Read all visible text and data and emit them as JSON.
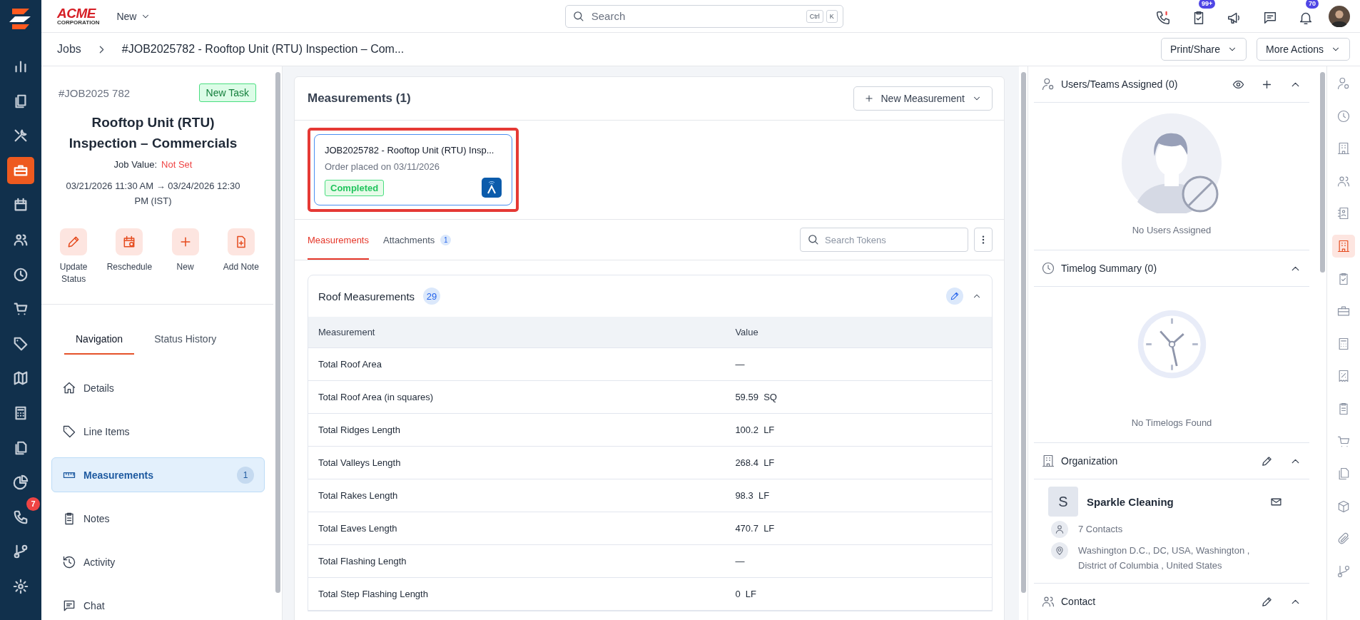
{
  "brand": {
    "name": "ACME",
    "tagline": "CORPORATION"
  },
  "top_bar": {
    "new_menu": "New",
    "search": {
      "placeholder": "Search",
      "keys": [
        "Ctrl",
        "K"
      ]
    },
    "task_badge": "99+",
    "bell_badge": "70"
  },
  "breadcrumb": {
    "parent": "Jobs",
    "title": "#JOB2025782 - Rooftop Unit (RTU) Inspection – Com...",
    "actions": [
      "Print/Share",
      "More Actions"
    ]
  },
  "left_rail": [
    {
      "selected": false
    },
    {
      "selected": false
    },
    {
      "selected": false
    },
    {
      "selected": true
    },
    {
      "selected": false
    },
    {
      "selected": false
    },
    {
      "selected": false
    },
    {
      "selected": false
    },
    {
      "selected": false
    },
    {
      "selected": false
    },
    {
      "selected": false
    },
    {
      "selected": false
    },
    {
      "selected": false
    },
    {
      "selected": false,
      "badge": "7"
    },
    {
      "selected": false
    },
    {
      "selected": false
    }
  ],
  "job": {
    "number": "#JOB2025 782",
    "tag": "New Task",
    "title": "Rooftop Unit (RTU) Inspection – Commercials",
    "value_label": "Job Value:",
    "value": "Not Set",
    "schedule": "03/21/2026 11:30 AM → 03/24/2026 12:30 PM (IST)",
    "actions": [
      "Update Status",
      "Reschedule",
      "New",
      "Add Note"
    ]
  },
  "panel_tabs": [
    {
      "label": "Navigation",
      "selected": true
    },
    {
      "label": "Status History",
      "selected": false
    }
  ],
  "nav": [
    {
      "label": "Details",
      "selected": false
    },
    {
      "label": "Line Items",
      "selected": false
    },
    {
      "label": "Measurements",
      "count": "1",
      "selected": true
    },
    {
      "label": "Notes",
      "selected": false
    },
    {
      "label": "Activity",
      "selected": false
    },
    {
      "label": "Chat",
      "selected": false
    }
  ],
  "measurements": {
    "title": "Measurements (1)",
    "new_button": "New Measurement",
    "cards": [
      {
        "title": "JOB2025782 - Rooftop Unit (RTU) Insp...",
        "subtitle": "Order placed on 03/11/2026",
        "status": "Completed",
        "highlighted": true
      }
    ],
    "tabs": [
      {
        "label": "Measurements",
        "selected": true
      },
      {
        "label": "Attachments",
        "count": "1",
        "selected": false
      }
    ],
    "search": {
      "placeholder": "Search Tokens"
    },
    "section": {
      "title": "Roof Measurements",
      "count": "29",
      "expanded": true,
      "columns": [
        "Measurement",
        "Value"
      ],
      "rows": [
        [
          "Total Roof Area",
          "—"
        ],
        [
          "Total Roof Area (in squares)",
          "59.59  SQ"
        ],
        [
          "Total Ridges Length",
          "100.2  LF"
        ],
        [
          "Total Valleys Length",
          "268.4  LF"
        ],
        [
          "Total Rakes Length",
          "98.3  LF"
        ],
        [
          "Total Eaves Length",
          "470.7  LF"
        ],
        [
          "Total Flashing Length",
          "—"
        ],
        [
          "Total Step Flashing Length",
          "0  LF"
        ]
      ]
    }
  },
  "right_panel": {
    "users": {
      "title": "Users/Teams Assigned (0)",
      "empty": "No Users Assigned"
    },
    "timelog": {
      "title": "Timelog Summary (0)",
      "empty": "No Timelogs Found"
    },
    "organization": {
      "title": "Organization",
      "initial": "S",
      "name": "Sparkle Cleaning",
      "contacts": "7 Contacts",
      "address": "Washington D.C., DC, USA, Washington , District of Columbia , United States"
    },
    "contact": {
      "title": "Contact"
    }
  },
  "right_rail": [
    {
      "selected": false
    },
    {
      "selected": false
    },
    {
      "selected": false
    },
    {
      "selected": false
    },
    {
      "selected": false
    },
    {
      "selected": true
    },
    {
      "selected": false
    },
    {
      "selected": false
    },
    {
      "selected": false
    },
    {
      "selected": false
    },
    {
      "selected": false
    },
    {
      "selected": false
    },
    {
      "selected": false
    },
    {
      "selected": false
    },
    {
      "selected": false
    },
    {
      "selected": false
    }
  ]
}
